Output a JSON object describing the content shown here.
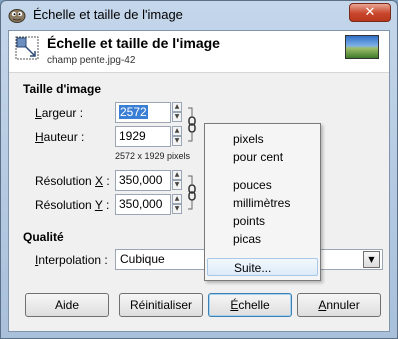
{
  "window": {
    "title": "Échelle et taille de l'image",
    "close_label": "✕"
  },
  "header": {
    "title": "Échelle et taille de l'image",
    "subtitle": "champ pente.jpg-42"
  },
  "image_size": {
    "section_label": "Taille d'image",
    "width_label_u": "L",
    "width_label_rest": "argeur :",
    "width_value": "2572",
    "height_label_u": "H",
    "height_label_rest": "auteur :",
    "height_value": "1929",
    "pixel_note": "2572 x 1929 pixels",
    "res_x_label_a": "Résolution ",
    "res_x_label_u": "X",
    "res_x_label_b": " :",
    "res_x_value": "350,000",
    "res_y_label_a": "Résolution ",
    "res_y_label_u": "Y",
    "res_y_label_b": " :",
    "res_y_value": "350,000"
  },
  "quality": {
    "section_label": "Qualité",
    "interp_label_u": "I",
    "interp_label_rest": "nterpolation :",
    "interp_value": "Cubique"
  },
  "unit_menu": {
    "items": [
      "pixels",
      "pour cent",
      "pouces",
      "millimètres",
      "points",
      "picas",
      "Suite..."
    ]
  },
  "buttons": {
    "help": "Aide",
    "reset": "Réinitialiser",
    "scale_u": "É",
    "scale_rest": "chelle",
    "cancel_u": "A",
    "cancel_rest": "nnuler"
  },
  "colors": {
    "selection": "#3a7fd6",
    "close_button": "#c9462c"
  },
  "icons": [
    "gimp-icon",
    "scale-image-icon",
    "image-thumbnail",
    "chain-link-icon",
    "spin-up-icon",
    "spin-down-icon",
    "dropdown-arrow-icon"
  ]
}
